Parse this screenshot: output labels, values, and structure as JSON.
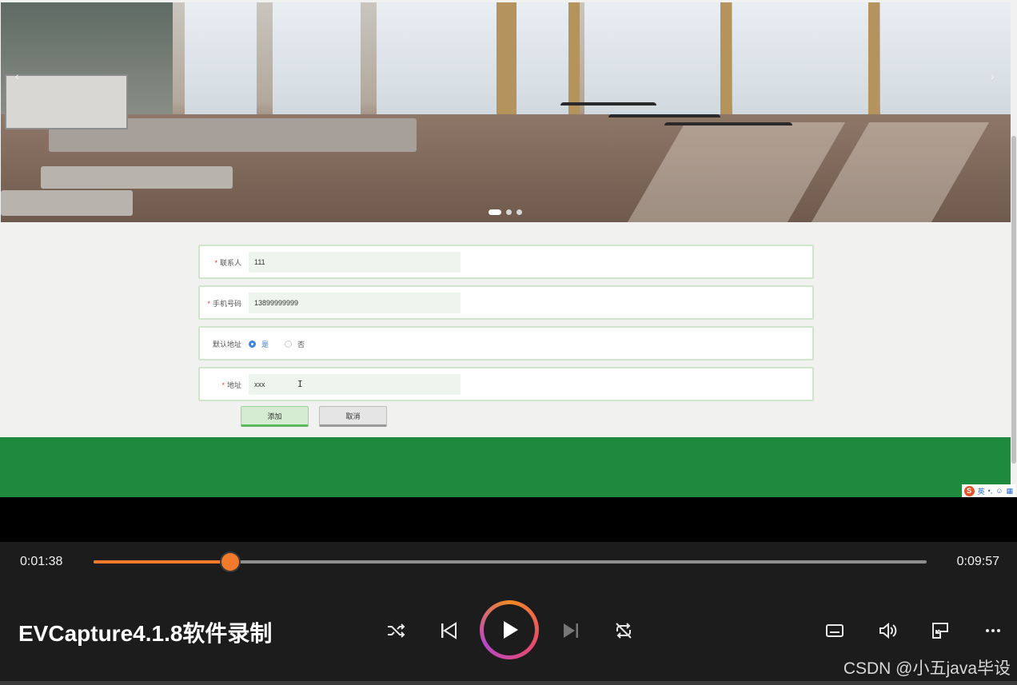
{
  "form": {
    "fields": [
      {
        "label": "联系人",
        "required": true,
        "value": "111"
      },
      {
        "label": "手机号码",
        "required": true,
        "value": "13899999999"
      },
      {
        "label": "默认地址",
        "required": false,
        "options": [
          "是",
          "否"
        ],
        "selected": "是"
      },
      {
        "label": "地址",
        "required": true,
        "value": "xxx"
      }
    ],
    "required_mark": "*",
    "add_label": "添加",
    "cancel_label": "取消"
  },
  "carousel": {
    "slide_count": 3,
    "active_index": 0
  },
  "ime": {
    "lang": "英",
    "brand": "S"
  },
  "player": {
    "current_time": "0:01:38",
    "total_time": "0:09:57",
    "progress_fraction": 0.1642,
    "title": "EVCapture4.1.8软件录制",
    "watermark": "CSDN @小五java毕设",
    "accent_color": "#f37a2b"
  }
}
